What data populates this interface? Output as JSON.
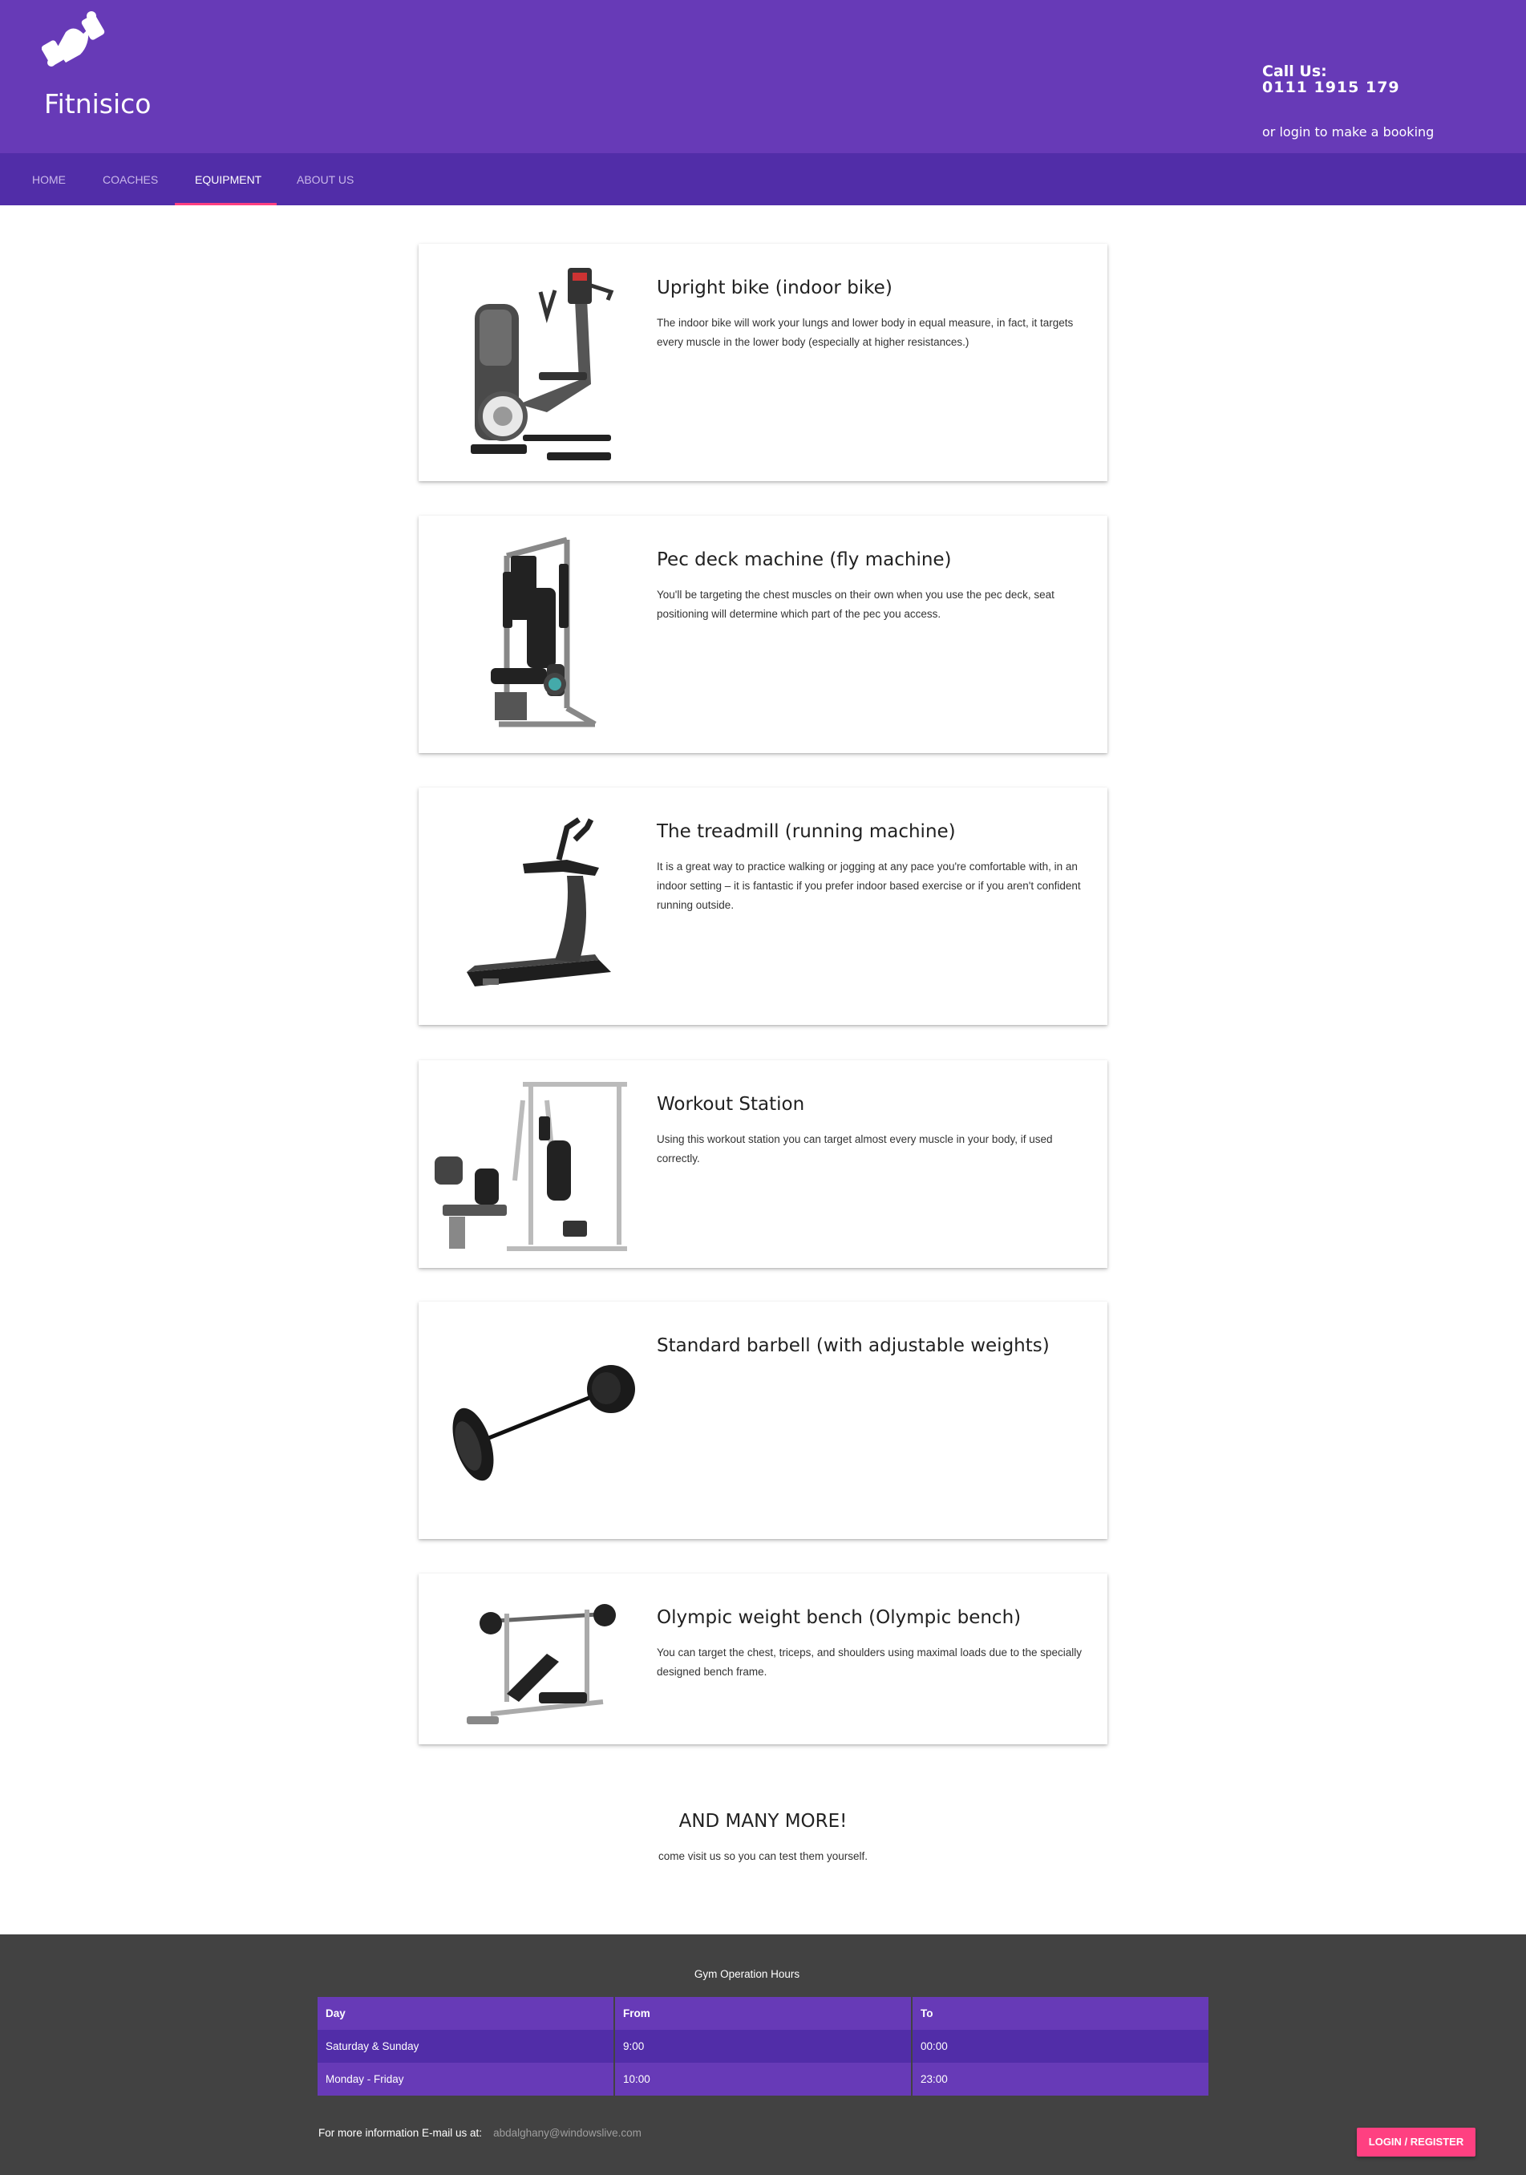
{
  "header": {
    "brand": "Fitnisico",
    "call_label": "Call Us:",
    "phone": "0111 1915 179",
    "login_hint": "or login to make a booking"
  },
  "nav": {
    "items": [
      {
        "label": "HOME"
      },
      {
        "label": "COACHES"
      },
      {
        "label": "EQUIPMENT",
        "active": true
      },
      {
        "label": "ABOUT US"
      }
    ]
  },
  "equipment": [
    {
      "title": "Upright bike (indoor bike)",
      "desc": "The indoor bike will work your lungs and lower body in equal measure, in fact, it targets every muscle in the lower body (especially at higher resistances.)",
      "image": "upright-bike-image"
    },
    {
      "title": "Pec deck machine (fly machine)",
      "desc": "You'll be targeting the chest muscles on their own when you use the pec deck, seat positioning will determine which part of the pec you access.",
      "image": "pec-deck-image"
    },
    {
      "title": "The treadmill (running machine)",
      "desc": "It is a great way to practice walking or jogging at any pace you're comfortable with, in an indoor setting – it is fantastic if you prefer indoor based exercise or if you aren't confident running outside.",
      "image": "treadmill-image"
    },
    {
      "title": "Workout Station",
      "desc": "Using this workout station you can target almost every muscle in your body, if used correctly.",
      "image": "workout-station-image"
    },
    {
      "title": "Standard barbell (with adjustable weights)",
      "desc": "",
      "image": "barbell-image"
    },
    {
      "title": "Olympic weight bench (Olympic bench)",
      "desc": "You can target the chest, triceps, and shoulders using maximal loads due to the specially designed bench frame.",
      "image": "olympic-bench-image"
    }
  ],
  "more": {
    "title": "AND MANY MORE!",
    "subtitle": "come visit us so you can test them yourself."
  },
  "footer": {
    "hours_title": "Gym Operation Hours",
    "columns": [
      "Day",
      "From",
      "To"
    ],
    "rows": [
      [
        "Saturday & Sunday",
        "9:00",
        "00:00"
      ],
      [
        "Monday - Friday",
        "10:00",
        "23:00"
      ]
    ],
    "info_label": "For more information E-mail us at:",
    "email": "abdalghany@windowslive.com",
    "login_button": "LOGIN / REGISTER"
  },
  "colors": {
    "header": "#673ab7",
    "nav": "#512da8",
    "accent": "#ff4081",
    "footer": "#424242"
  }
}
